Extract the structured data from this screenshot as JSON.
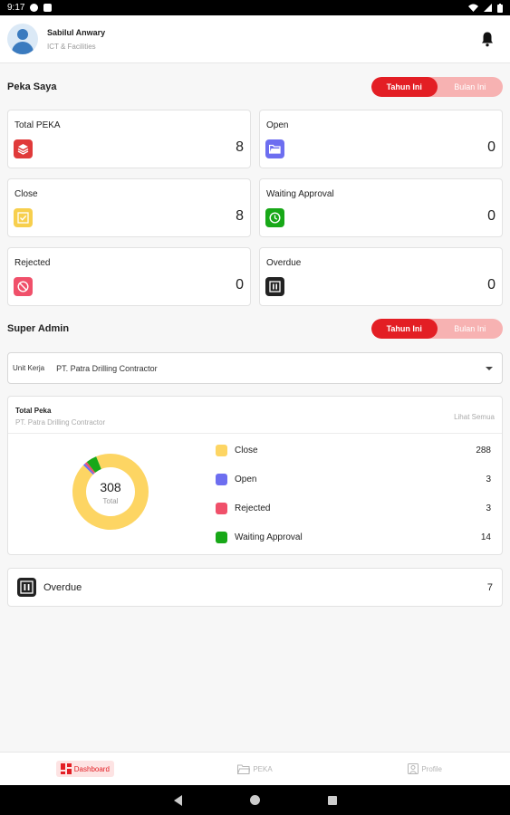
{
  "status_bar": {
    "time": "9:17"
  },
  "user": {
    "name": "Sabilul Anwary",
    "department": "ICT & Facilities"
  },
  "peka_saya": {
    "title": "Peka Saya",
    "toggle": {
      "active": "Tahun Ini",
      "inactive": "Bulan Ini"
    },
    "cards": [
      {
        "label": "Total PEKA",
        "value": "8",
        "icon": "layers-icon",
        "color": "#e03a3a"
      },
      {
        "label": "Open",
        "value": "0",
        "icon": "folder-open-icon",
        "color": "#6d6ef0"
      },
      {
        "label": "Close",
        "value": "8",
        "icon": "check-square-icon",
        "color": "#f7cf4d"
      },
      {
        "label": "Waiting Approval",
        "value": "0",
        "icon": "clock-icon",
        "color": "#18a818"
      },
      {
        "label": "Rejected",
        "value": "0",
        "icon": "prohibited-icon",
        "color": "#f0506a"
      },
      {
        "label": "Overdue",
        "value": "0",
        "icon": "pause-box-icon",
        "color": "#222222"
      }
    ]
  },
  "super_admin": {
    "title": "Super Admin",
    "toggle": {
      "active": "Tahun Ini",
      "inactive": "Bulan Ini"
    },
    "unit_kerja": {
      "label": "Unit Kerja",
      "value": "PT. Patra Drilling Contractor"
    }
  },
  "summary": {
    "title": "Total Peka",
    "subtitle": "PT. Patra Drilling Contractor",
    "see_all": "Lihat Semua",
    "total": "308",
    "total_caption": "Total"
  },
  "chart_data": {
    "type": "pie",
    "donut": true,
    "categories": [
      "Close",
      "Open",
      "Rejected",
      "Waiting Approval"
    ],
    "values": [
      288,
      3,
      3,
      14
    ],
    "colors": [
      "#fdd563",
      "#6d6ef0",
      "#f0506a",
      "#18a818"
    ]
  },
  "overdue": {
    "label": "Overdue",
    "value": "7"
  },
  "bottom_nav": {
    "dashboard": "Dashboard",
    "peka": "PEKA",
    "profile": "Profile"
  },
  "colors": {
    "accent": "#e31e24",
    "accent_light": "#f7b2b2"
  }
}
